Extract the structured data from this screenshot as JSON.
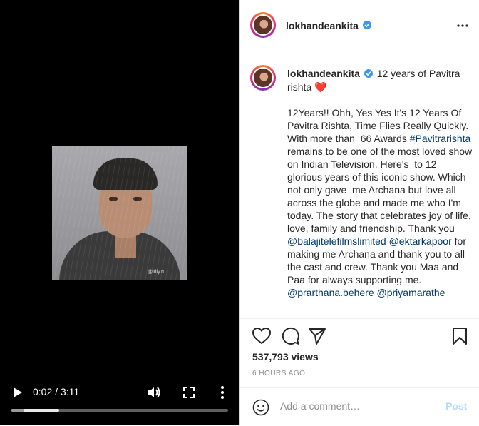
{
  "video": {
    "time_display": "0:02 / 3:11",
    "progress": 0.22,
    "buffered": 0.06,
    "watermark": "@idly.ru",
    "icons": {
      "play": "play-icon",
      "volume": "volume-icon",
      "fullscreen": "fullscreen-icon",
      "more": "more-vertical-icon"
    }
  },
  "header": {
    "username": "lokhandeankita",
    "verified": true
  },
  "caption": {
    "username": "lokhandeankita",
    "headline": "12 years of Pavitra rishta",
    "heart": "❤️",
    "body_p1": "12Years!! Ohh, Yes Yes It's 12 Years Of Pavitra Rishta, Time Flies Really Quickly. With more than  66 Awards ",
    "hashtag": "#Pavitrarishta",
    "body_p2": "  remains to be one of the most loved show on Indian Television. Here's  to 12 glorious years of this iconic show. Which not only gave  me Archana but love all across the globe and made me who I'm  today. The story that celebrates joy of life, love, family and friendship. Thank you ",
    "mention1": "@balajitelefilmslimited",
    "mention2": "@ektarkapoor",
    "body_p3": " for making me Archana and thank you to all the cast and crew. Thank you Maa and Paa for always supporting me. ",
    "mention3": "@prarthana.behere",
    "mention4": "@priyamarathe"
  },
  "stats": {
    "views": "537,793 views",
    "time_ago": "6 HOURS AGO"
  },
  "comment": {
    "placeholder": "Add a comment…",
    "post_label": "Post"
  },
  "colors": {
    "link": "#00376b",
    "verified": "#3897f0",
    "post_disabled": "#b3dbff"
  }
}
